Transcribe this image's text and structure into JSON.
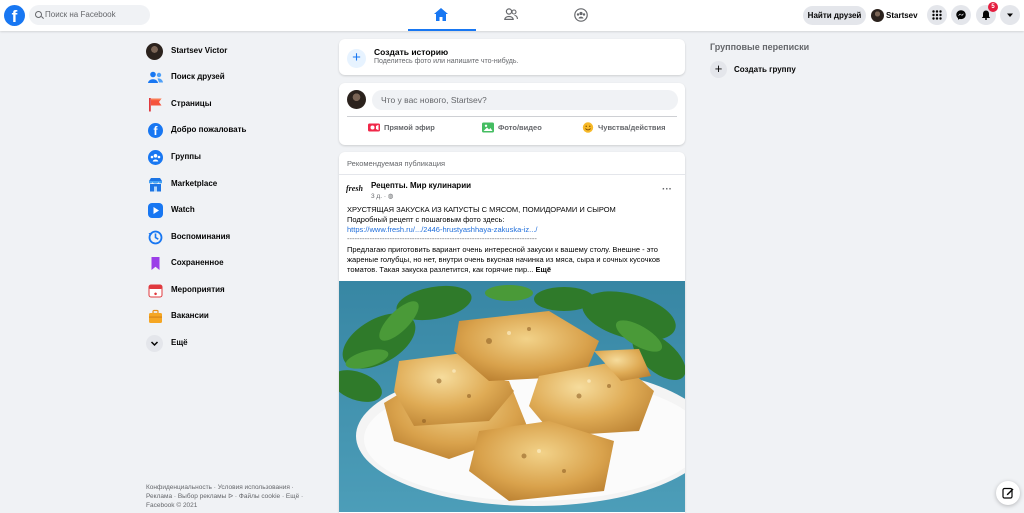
{
  "topbar": {
    "logo_letter": "f",
    "search_placeholder": "Поиск на Facebook",
    "find_friends": "Найти друзей",
    "profile_name": "Startsev",
    "notification_count": "5"
  },
  "sidebar": {
    "items": [
      {
        "label": "Startsev Victor",
        "icon": "avatar"
      },
      {
        "label": "Поиск друзей",
        "icon": "friends-icon"
      },
      {
        "label": "Страницы",
        "icon": "pages-flag-icon"
      },
      {
        "label": "Добро пожаловать",
        "icon": "facebook-icon"
      },
      {
        "label": "Группы",
        "icon": "groups-icon"
      },
      {
        "label": "Marketplace",
        "icon": "marketplace-icon"
      },
      {
        "label": "Watch",
        "icon": "watch-icon"
      },
      {
        "label": "Воспоминания",
        "icon": "memories-icon"
      },
      {
        "label": "Сохраненное",
        "icon": "saved-icon"
      },
      {
        "label": "Мероприятия",
        "icon": "events-icon"
      },
      {
        "label": "Вакансии",
        "icon": "jobs-icon"
      },
      {
        "label": "Ещё",
        "icon": "chevron-down-icon"
      }
    ],
    "footer": "Конфиденциальность · Условия использования · Реклама · Выбор рекламы ᐅ · Файлы cookie · Ещё · Facebook © 2021"
  },
  "story": {
    "title": "Создать историю",
    "subtitle": "Поделитесь фото или напишите что-нибудь."
  },
  "composer": {
    "placeholder": "Что у вас нового, Startsev?",
    "actions": [
      "Прямой эфир",
      "Фото/видео",
      "Чувства/действия"
    ]
  },
  "post": {
    "recommended_label": "Рекомендуемая публикация",
    "page_logo_text": "fresh",
    "page_name": "Рецепты. Мир кулинарии",
    "time": "3 д. · ◍",
    "more": "···",
    "headline": "ХРУСТЯЩАЯ ЗАКУСКА ИЗ КАПУСТЫ С МЯСОМ, ПОМИДОРАМИ И СЫРОМ",
    "intro": "Подробный рецепт с пошаговым фото здесь:",
    "link": "https://www.fresh.ru/.../2446-hrustyashhaya-zakuska-iz.../",
    "divider": "----------------------------------------------------------------------------",
    "body": "Предлагаю приготовить вариант очень интересной закуски к вашему столу. Внешне - это жареные голубцы, но нет, внутри очень вкусная начинка из мяса, сыра и сочных кусочков томатов. Такая закуска разлетится, как горячие пир...",
    "see_more": "Ещё"
  },
  "right": {
    "group_chats_title": "Групповые переписки",
    "create_group": "Создать группу"
  },
  "colors": {
    "accent": "#1877f2",
    "background": "#f0f2f5",
    "badge": "#e41e3f"
  }
}
